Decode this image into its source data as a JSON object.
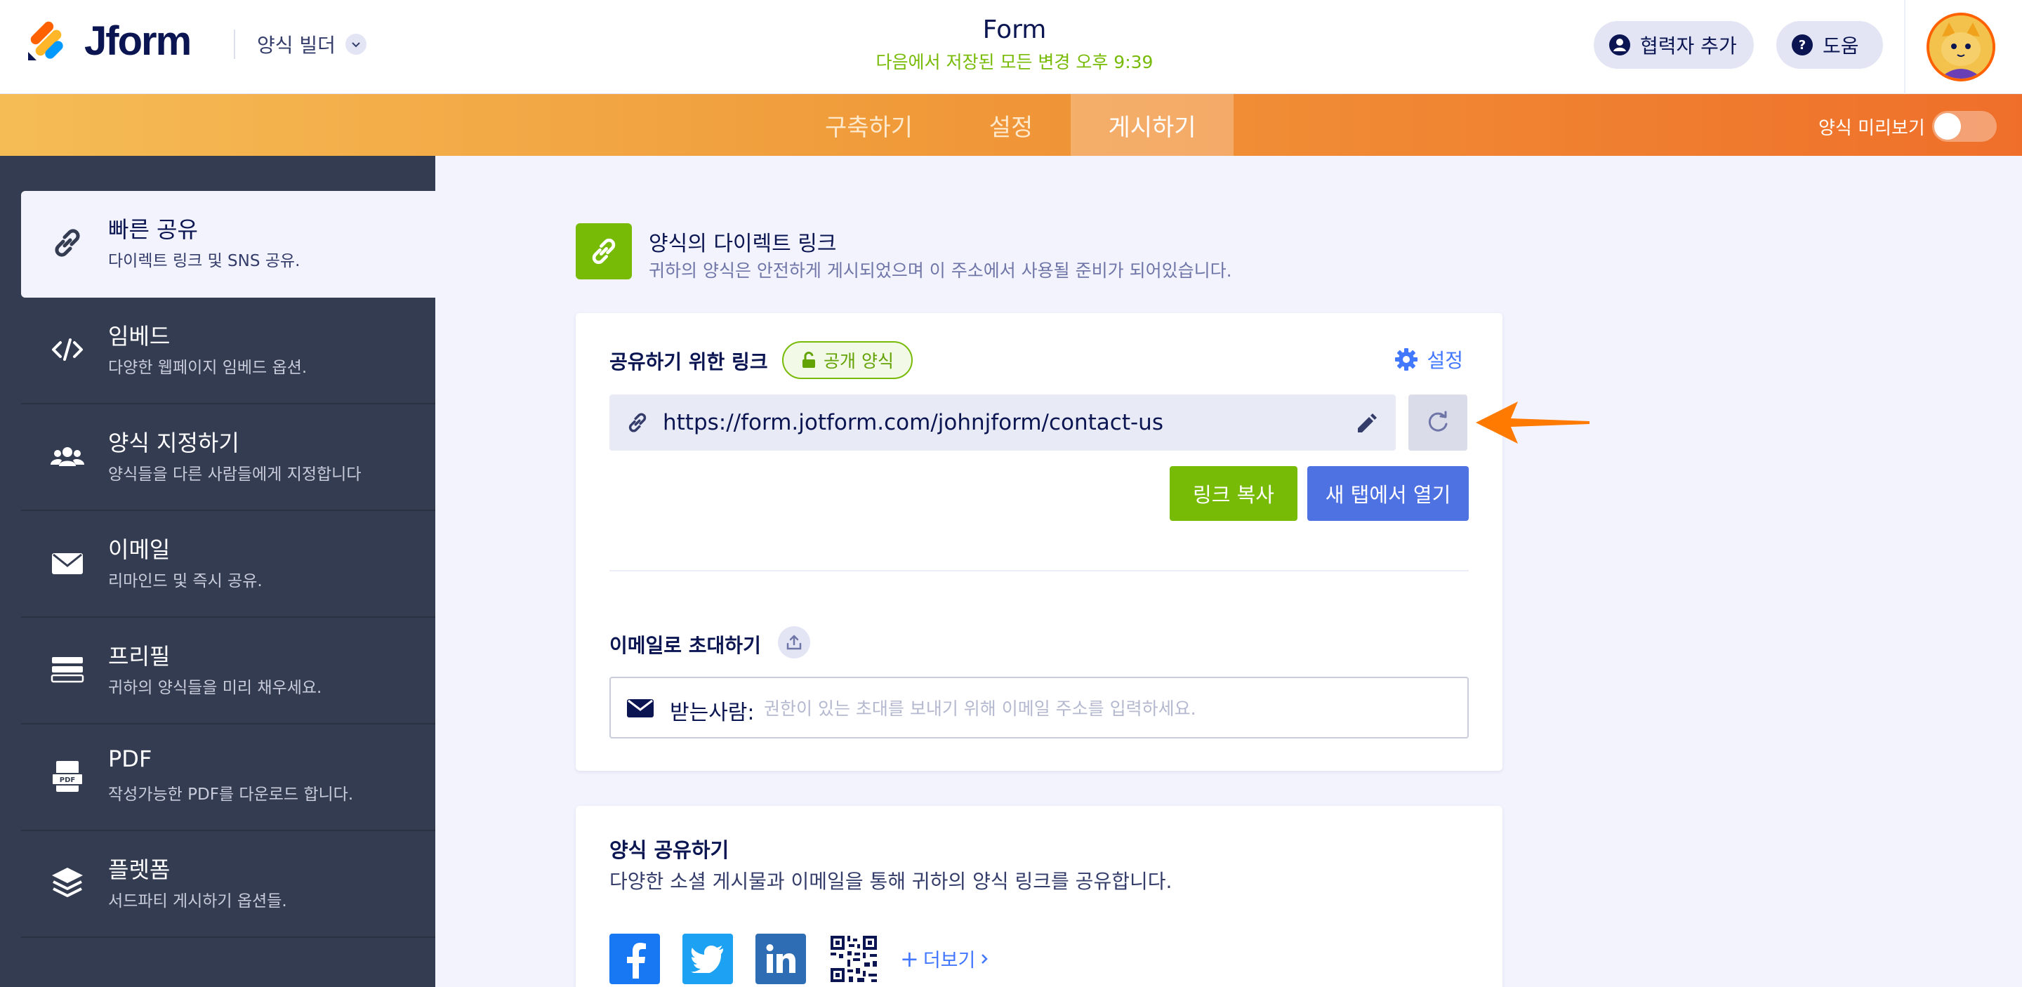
{
  "header": {
    "logo_text": "Jform",
    "builder_menu_label": "양식 빌더",
    "form_title": "Form",
    "saved_status": "다음에서 저장된 모든 변경 오후 9:39",
    "add_collaborator_label": "협력자 추가",
    "help_label": "도움"
  },
  "tabs": {
    "build": "구축하기",
    "settings": "설정",
    "publish": "게시하기",
    "active": "publish",
    "preview_label": "양식 미리보기",
    "preview_enabled": false
  },
  "sidebar": {
    "active_index": 0,
    "items": [
      {
        "title": "빠른 공유",
        "desc": "다이렉트 링크 및 SNS 공유.",
        "icon": "link-icon"
      },
      {
        "title": "임베드",
        "desc": "다양한 웹페이지 임베드 옵션.",
        "icon": "code-icon"
      },
      {
        "title": "양식 지정하기",
        "desc": "양식들을 다른 사람들에게 지정합니다",
        "icon": "users-icon"
      },
      {
        "title": "이메일",
        "desc": "리마인드 및 즉시 공유.",
        "icon": "envelope-icon"
      },
      {
        "title": "프리필",
        "desc": "귀하의 양식들을 미리 채우세요.",
        "icon": "prefill-icon"
      },
      {
        "title": "PDF",
        "desc": "작성가능한 PDF를 다운로드 합니다.",
        "icon": "pdf-icon"
      },
      {
        "title": "플렛폼",
        "desc": "서드파티 게시하기 옵션들.",
        "icon": "layers-icon"
      }
    ]
  },
  "direct_link": {
    "title": "양식의 다이렉트 링크",
    "subtitle": "귀하의 양식은 안전하게 게시되었으며 이 주소에서 사용될 준비가 되어있습니다.",
    "share_label": "공유하기 위한 링크",
    "public_badge": "공개 양식",
    "settings_label": "설정",
    "url": "https://form.jotform.com/johnjform/contact-us",
    "copy_label": "링크 복사",
    "open_label": "새 탭에서 열기",
    "invite_label": "이메일로 초대하기",
    "to_label": "받는사람:",
    "email_placeholder": "권한이 있는 초대를 보내기 위해 이메일 주소를 입력하세요."
  },
  "share": {
    "title": "양식 공유하기",
    "subtitle": "다양한 소셜 게시물과 이메일을 통해 귀하의 양식 링크를 공유합니다.",
    "more_label": "더보기",
    "networks": [
      "facebook-icon",
      "twitter-icon",
      "linkedin-icon",
      "qr-code-icon"
    ]
  },
  "colors": {
    "brand_green": "#78bb07",
    "brand_blue": "#4f72e3",
    "accent_orange": "#ff6100",
    "sidebar_bg": "#343c51"
  }
}
